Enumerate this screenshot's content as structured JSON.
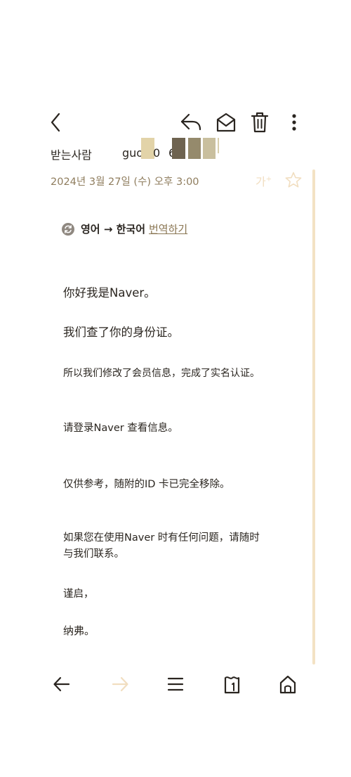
{
  "toolbar": {
    "back_icon": "chevron-left-icon",
    "reply_icon": "reply-icon",
    "mark_unread_icon": "envelope-open-icon",
    "delete_icon": "trash-icon",
    "more_icon": "more-vertical-icon"
  },
  "header": {
    "recipient_label": "받는사람",
    "recipient_value": "guo",
    "recipient_value_tail": "0",
    "recipient_value_tail2": "6",
    "date": "2024년 3월 27일 (수) 오후 3:00",
    "font_size_label": "가",
    "font_size_sup": "+",
    "star_icon": "star-icon"
  },
  "translate": {
    "languages": "영어 → 한국어",
    "action": "번역하기",
    "icon": "refresh-icon"
  },
  "body": {
    "lines": [
      "你好我是Naver。",
      "我们查了你的身份证。",
      "所以我们修改了会员信息，完成了实名认证。",
      "请登录Naver 查看信息。",
      "仅供参考，随附的ID 卡已完全移除。",
      "如果您在使用Naver 时有任何问题，请随时",
      "与我们联系。",
      "谨启，",
      "纳弗。"
    ]
  },
  "bottom_nav": {
    "back_icon": "arrow-left-icon",
    "forward_icon": "arrow-right-icon",
    "menu_icon": "menu-icon",
    "notes_icon": "notes-icon",
    "home_icon": "home-icon"
  },
  "colors": {
    "accent": "#8a7653",
    "date": "#8f7d5e",
    "scrollbar": "#f3e2c4",
    "disabled": "#f1dec0",
    "text": "#2b2620"
  }
}
